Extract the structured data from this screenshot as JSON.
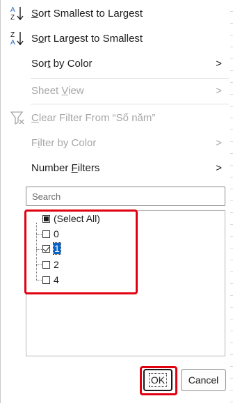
{
  "menu": {
    "sort_asc": "Sort Smallest to Largest",
    "sort_asc_u": "S",
    "sort_asc_rest": "ort Smallest to Largest",
    "sort_desc_u": "o",
    "sort_desc_pre": "S",
    "sort_desc_rest": "rt Largest to Smallest",
    "sort_by_color_pre": "Sor",
    "sort_by_color_u": "t",
    "sort_by_color_rest": " by Color",
    "sheet_view_pre": "Sheet ",
    "sheet_view_u": "V",
    "sheet_view_rest": "iew",
    "clear_filter_u": "C",
    "clear_filter_rest": "lear Filter From “Số năm”",
    "filter_by_color_pre": "F",
    "filter_by_color_u": "i",
    "filter_by_color_rest": "lter by Color",
    "number_filters_pre": "Number ",
    "number_filters_u": "F",
    "number_filters_rest": "ilters",
    "chevron": ">"
  },
  "search": {
    "placeholder": "Search"
  },
  "filter_list": {
    "items": [
      {
        "label": "(Select All)",
        "state": "indeterminate"
      },
      {
        "label": "0",
        "state": "unchecked"
      },
      {
        "label": "1",
        "state": "checked"
      },
      {
        "label": "2",
        "state": "unchecked"
      },
      {
        "label": "4",
        "state": "unchecked"
      }
    ]
  },
  "buttons": {
    "ok": "OK",
    "cancel": "Cancel"
  },
  "icons": {
    "sort_asc": "sort-ascending-az-icon",
    "sort_desc": "sort-descending-za-icon",
    "clear_filter": "clear-filter-funnel-icon"
  },
  "colors": {
    "highlight": "#e1000f",
    "selection": "#0a64c8",
    "az_blue": "#2b6cc4"
  }
}
